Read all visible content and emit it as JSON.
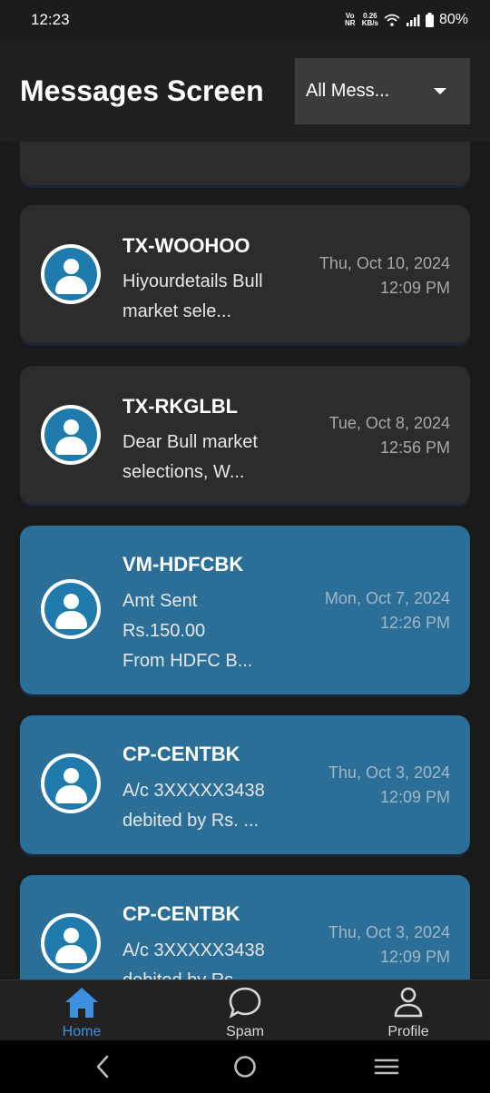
{
  "status_bar": {
    "time": "12:23",
    "network_type": "Vo NR",
    "speed_value": "0.26",
    "speed_unit": "KB/s",
    "battery": "80%"
  },
  "header": {
    "title": "Messages Screen",
    "filter": {
      "selected": "All Mess..."
    }
  },
  "messages": [
    {
      "sender": "TX-WOOHOO",
      "preview_line1": "Hiyourdetails Bull",
      "preview_line2": "market sele...",
      "preview_line3": "",
      "date": "Thu, Oct 10, 2024",
      "time": "12:09 PM",
      "style": "dark"
    },
    {
      "sender": "TX-RKGLBL",
      "preview_line1": "Dear Bull market",
      "preview_line2": "selections, W...",
      "preview_line3": "",
      "date": "Tue, Oct 8, 2024",
      "time": "12:56 PM",
      "style": "dark"
    },
    {
      "sender": "VM-HDFCBK",
      "preview_line1": "Amt Sent",
      "preview_line2": "Rs.150.00",
      "preview_line3": "From HDFC B...",
      "date": "Mon, Oct 7, 2024",
      "time": "12:26 PM",
      "style": "blue"
    },
    {
      "sender": "CP-CENTBK",
      "preview_line1": "A/c 3XXXXX3438",
      "preview_line2": "debited by Rs. ...",
      "preview_line3": "",
      "date": "Thu, Oct 3, 2024",
      "time": "12:09 PM",
      "style": "blue"
    },
    {
      "sender": "CP-CENTBK",
      "preview_line1": "A/c 3XXXXX3438",
      "preview_line2": "debited by Rs. ...",
      "preview_line3": "",
      "date": "Thu, Oct 3, 2024",
      "time": "12:09 PM",
      "style": "blue"
    }
  ],
  "bottom_nav": {
    "items": [
      {
        "label": "Home",
        "icon": "home-icon",
        "active": true
      },
      {
        "label": "Spam",
        "icon": "chat-bubble-icon",
        "active": false
      },
      {
        "label": "Profile",
        "icon": "person-icon",
        "active": false
      }
    ]
  },
  "system_nav": {
    "buttons": [
      "back-icon",
      "home-circle-icon",
      "recents-icon"
    ]
  },
  "colors": {
    "accent": "#3f8fe0",
    "card_dark": "#2c2c2c",
    "card_blue": "#2b6f98",
    "avatar_blue": "#1f7bab",
    "background": "#1a1a1a"
  }
}
